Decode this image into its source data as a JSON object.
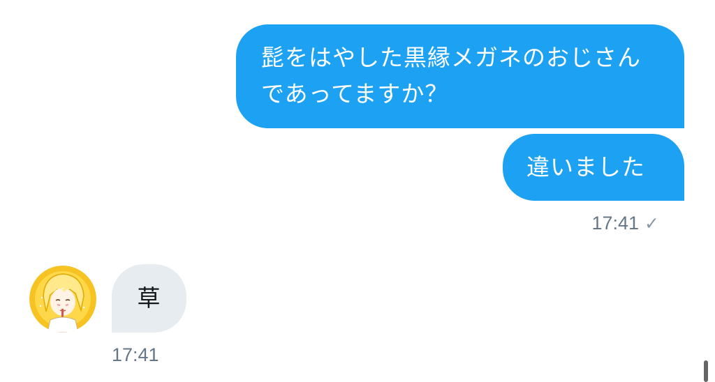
{
  "conversation": {
    "messages": [
      {
        "direction": "outgoing",
        "text": "髭をはやした黒縁メガネのおじさんであってますか？"
      },
      {
        "direction": "outgoing",
        "text": "違いました"
      },
      {
        "direction": "incoming",
        "text": "草"
      }
    ],
    "outgoing_meta": {
      "time": "17:41",
      "read_icon": "checkmark-icon"
    },
    "incoming_meta": {
      "time": "17:41"
    },
    "sender_avatar": {
      "icon": "avatar-icon",
      "description_color": "#f6c323"
    }
  },
  "colors": {
    "outgoing_bubble": "#1da1f2",
    "incoming_bubble": "#e6ecf0",
    "timestamp": "#657786"
  }
}
